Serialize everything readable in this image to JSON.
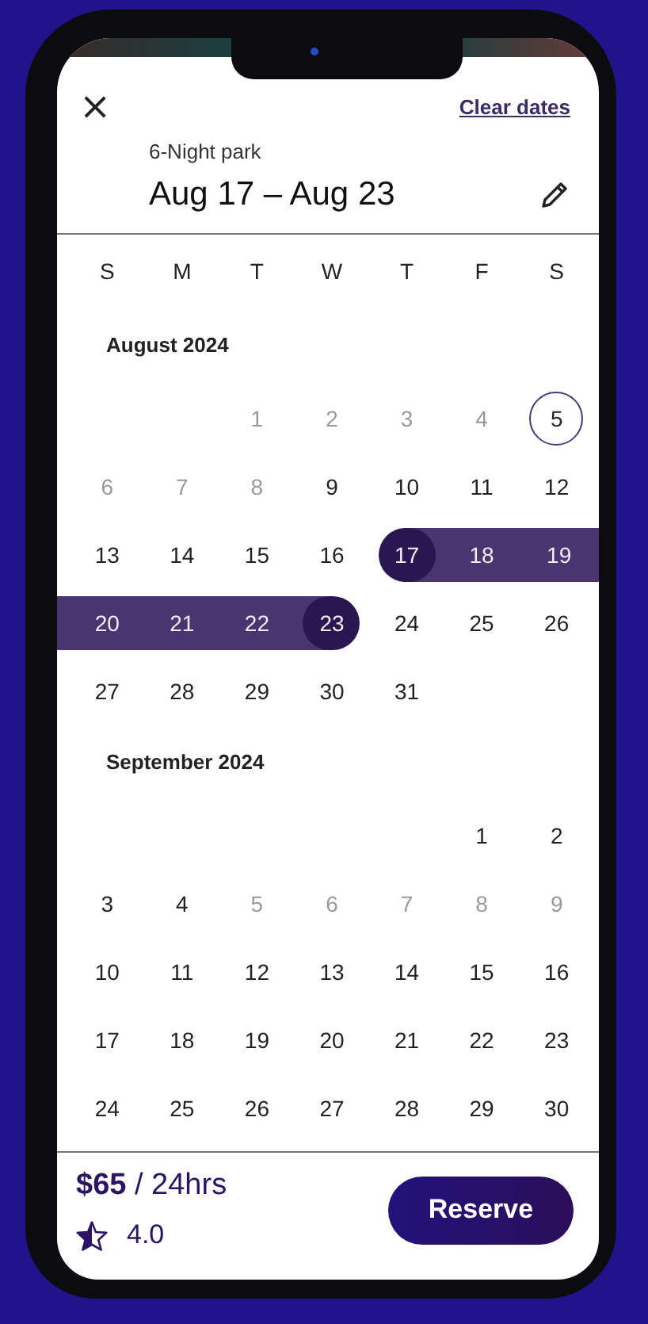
{
  "header": {
    "close_label": "×",
    "clear_link": "Clear dates",
    "subtitle": "6-Night park",
    "title": "Aug 17 – Aug 23"
  },
  "weekdays": [
    "S",
    "M",
    "T",
    "W",
    "T",
    "F",
    "S"
  ],
  "months": [
    {
      "title": "August 2024",
      "weeks": [
        [
          {
            "kind": "blank"
          },
          {
            "kind": "blank"
          },
          {
            "d": "1",
            "kind": "past"
          },
          {
            "d": "2",
            "kind": "past"
          },
          {
            "d": "3",
            "kind": "past"
          },
          {
            "d": "4",
            "kind": "past"
          },
          {
            "d": "5",
            "kind": "today"
          }
        ],
        [
          {
            "d": "6",
            "kind": "past"
          },
          {
            "d": "7",
            "kind": "past"
          },
          {
            "d": "8",
            "kind": "past"
          },
          {
            "d": "9",
            "kind": "normal"
          },
          {
            "d": "10",
            "kind": "normal"
          },
          {
            "d": "11",
            "kind": "normal"
          },
          {
            "d": "12",
            "kind": "normal"
          }
        ],
        [
          {
            "d": "13",
            "kind": "normal"
          },
          {
            "d": "14",
            "kind": "normal"
          },
          {
            "d": "15",
            "kind": "normal"
          },
          {
            "d": "16",
            "kind": "normal"
          },
          {
            "d": "17",
            "kind": "start"
          },
          {
            "d": "18",
            "kind": "range"
          },
          {
            "d": "19",
            "kind": "range"
          }
        ],
        [
          {
            "d": "20",
            "kind": "range"
          },
          {
            "d": "21",
            "kind": "range"
          },
          {
            "d": "22",
            "kind": "range"
          },
          {
            "d": "23",
            "kind": "end"
          },
          {
            "d": "24",
            "kind": "normal"
          },
          {
            "d": "25",
            "kind": "normal"
          },
          {
            "d": "26",
            "kind": "normal"
          }
        ],
        [
          {
            "d": "27",
            "kind": "normal"
          },
          {
            "d": "28",
            "kind": "normal"
          },
          {
            "d": "29",
            "kind": "normal"
          },
          {
            "d": "30",
            "kind": "normal"
          },
          {
            "d": "31",
            "kind": "normal"
          }
        ]
      ]
    },
    {
      "title": "September 2024",
      "weeks": [
        [
          {
            "kind": "blank"
          },
          {
            "kind": "blank"
          },
          {
            "kind": "blank"
          },
          {
            "kind": "blank"
          },
          {
            "kind": "blank"
          },
          {
            "d": "1",
            "kind": "normal"
          },
          {
            "d": "2",
            "kind": "normal"
          }
        ],
        [
          {
            "d": "3",
            "kind": "normal"
          },
          {
            "d": "4",
            "kind": "normal"
          },
          {
            "d": "5",
            "kind": "past"
          },
          {
            "d": "6",
            "kind": "past"
          },
          {
            "d": "7",
            "kind": "past"
          },
          {
            "d": "8",
            "kind": "past"
          },
          {
            "d": "9",
            "kind": "past"
          }
        ],
        [
          {
            "d": "10",
            "kind": "normal"
          },
          {
            "d": "11",
            "kind": "normal"
          },
          {
            "d": "12",
            "kind": "normal"
          },
          {
            "d": "13",
            "kind": "normal"
          },
          {
            "d": "14",
            "kind": "normal"
          },
          {
            "d": "15",
            "kind": "normal"
          },
          {
            "d": "16",
            "kind": "normal"
          }
        ],
        [
          {
            "d": "17",
            "kind": "normal"
          },
          {
            "d": "18",
            "kind": "normal"
          },
          {
            "d": "19",
            "kind": "normal"
          },
          {
            "d": "20",
            "kind": "normal"
          },
          {
            "d": "21",
            "kind": "normal"
          },
          {
            "d": "22",
            "kind": "normal"
          },
          {
            "d": "23",
            "kind": "normal"
          }
        ],
        [
          {
            "d": "24",
            "kind": "normal"
          },
          {
            "d": "25",
            "kind": "normal"
          },
          {
            "d": "26",
            "kind": "normal"
          },
          {
            "d": "27",
            "kind": "normal"
          },
          {
            "d": "28",
            "kind": "normal"
          },
          {
            "d": "29",
            "kind": "normal"
          },
          {
            "d": "30",
            "kind": "normal"
          }
        ]
      ]
    }
  ],
  "footer": {
    "price": "**$65** / 24hrs",
    "rating": "4.0",
    "button": "Reserve"
  }
}
